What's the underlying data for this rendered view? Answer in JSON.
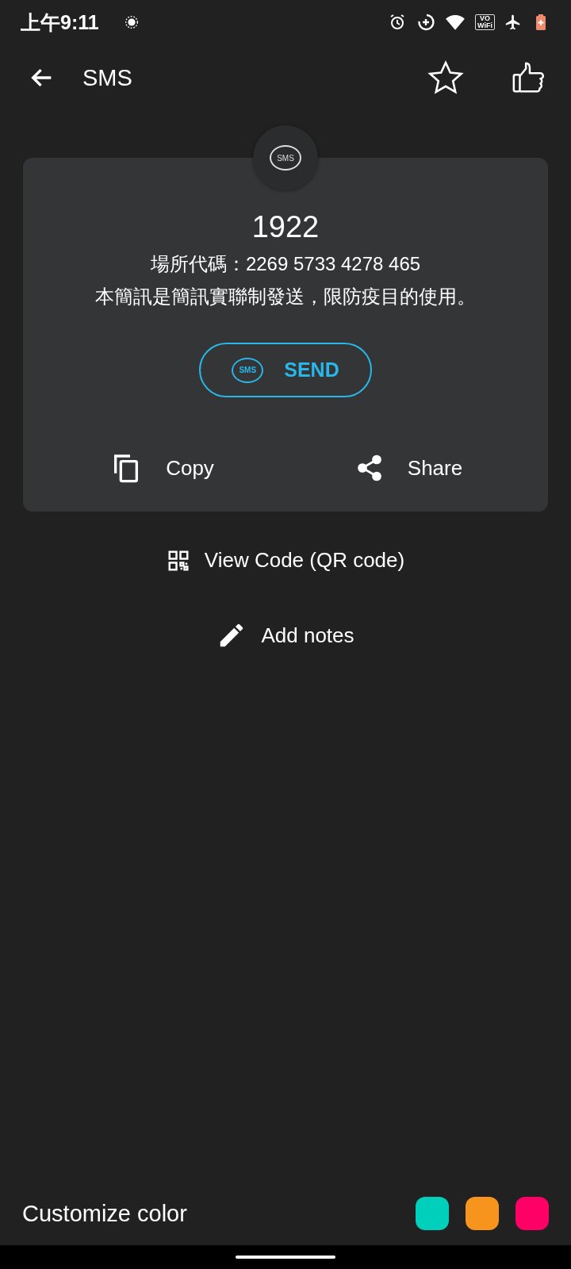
{
  "status_bar": {
    "time": "上午9:11",
    "vowifi_label": [
      "VO",
      "WiFi"
    ]
  },
  "app_bar": {
    "title": "SMS",
    "favorite": false
  },
  "card": {
    "badge_label": "SMS",
    "number": "1922",
    "lines": [
      "場所代碼：2269 5733 4278 465",
      "本簡訊是簡訊實聯制發送，限防疫目的使用。"
    ],
    "send_button": {
      "icon_label": "SMS",
      "label": "SEND"
    },
    "actions": [
      {
        "kind": "copy",
        "label": "Copy"
      },
      {
        "kind": "share",
        "label": "Share"
      }
    ]
  },
  "links": [
    {
      "kind": "qr",
      "label": "View Code (QR code)"
    },
    {
      "kind": "notes",
      "label": "Add notes"
    }
  ],
  "customize": {
    "label": "Customize color",
    "colors": [
      {
        "color": "#00cfbb"
      },
      {
        "color": "#f7941d"
      },
      {
        "color": "#ff0066"
      }
    ]
  }
}
